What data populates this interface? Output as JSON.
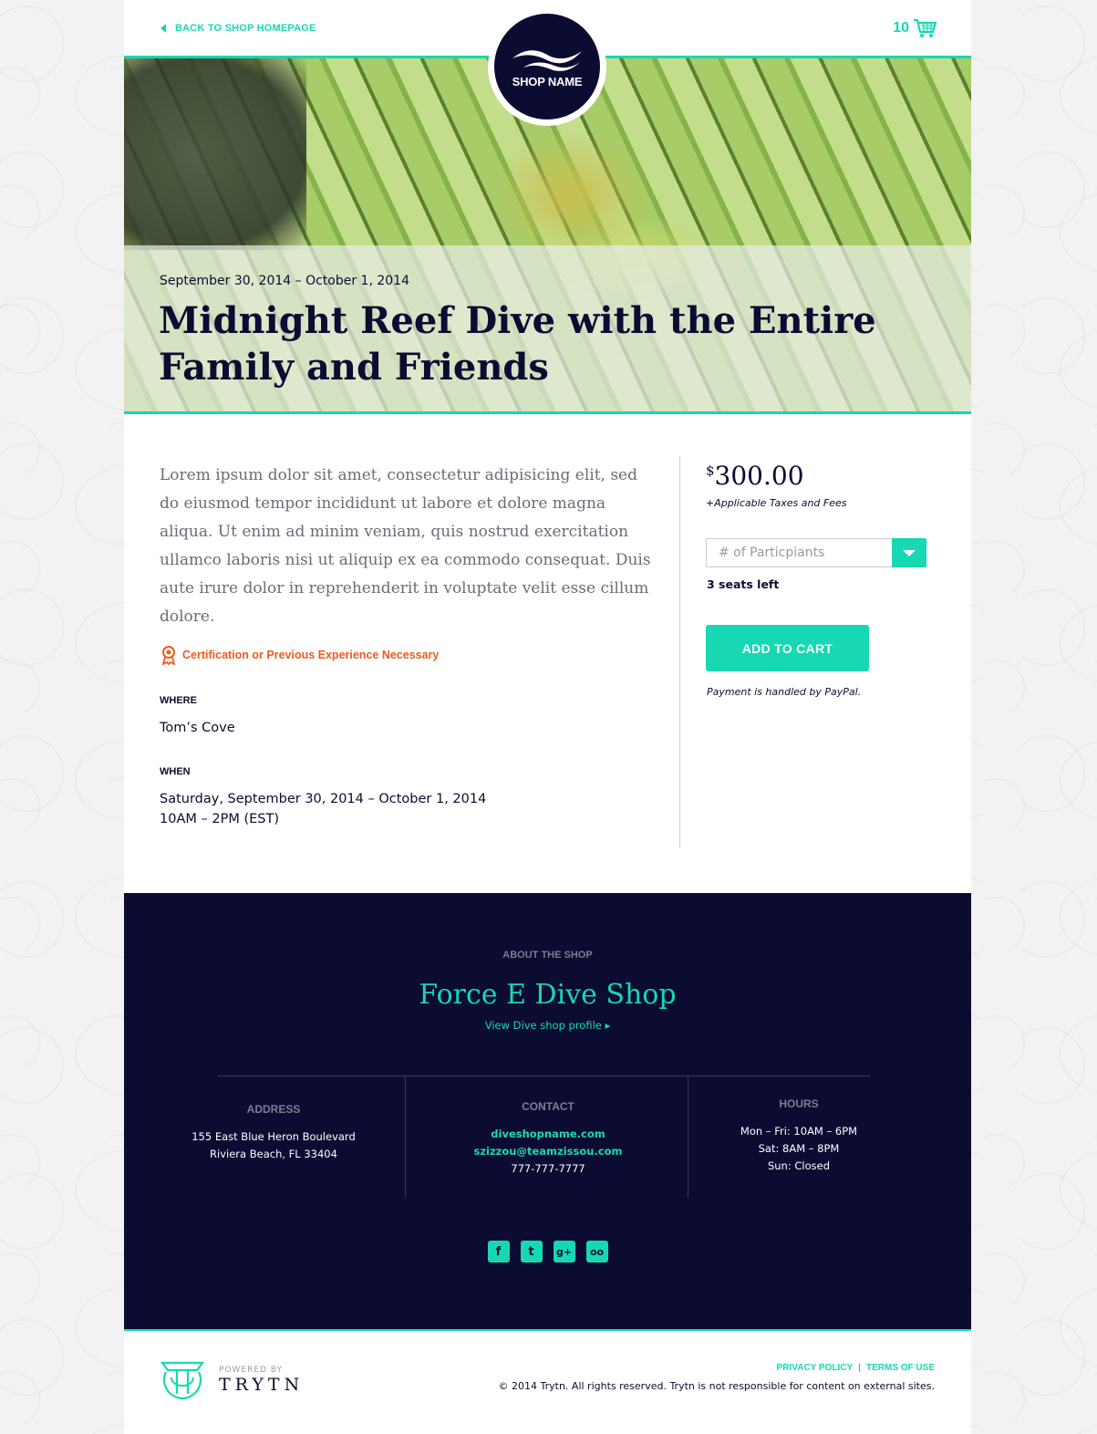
{
  "header": {
    "back_label": "BACK TO SHOP HOMEPAGE",
    "cart_count": "10",
    "logo_name": "SHOP NAME"
  },
  "event": {
    "date_range": "September 30, 2014 – October 1, 2014",
    "title": "Midnight Reef Dive with the Entire Family and Friends",
    "description": "Lorem ipsum dolor sit amet, consectetur adipisicing elit, sed do eiusmod tempor incididunt ut labore et dolore magna aliqua. Ut enim ad minim veniam, quis nostrud exercitation ullamco laboris nisi ut aliquip ex ea commodo consequat. Duis aute irure dolor in reprehenderit in voluptate velit esse cillum dolore.",
    "requirement": "Certification or Previous Experience Necessary",
    "where_label": "WHERE",
    "where_value": "Tom’s Cove",
    "when_label": "WHEN",
    "when_line1": "Saturday, September 30, 2014 – October 1, 2014",
    "when_line2": "10AM – 2PM (EST)"
  },
  "purchase": {
    "currency": "$",
    "price": "300.00",
    "taxes_note": "+Applicable Taxes and Fees",
    "participants_placeholder": "# of Particpiants",
    "seats_left": "3 seats left",
    "add_to_cart": "ADD TO CART",
    "payment_note": "Payment is handled by PayPal."
  },
  "shop": {
    "about_label": "ABOUT THE SHOP",
    "name": "Force E Dive Shop",
    "profile_link": "View Dive shop profile ▸",
    "address_title": "ADDRESS",
    "address_line1": "155 East Blue Heron Boulevard",
    "address_line2": "Riviera Beach, FL 33404",
    "contact_title": "CONTACT",
    "contact_web": "diveshopname.com",
    "contact_email": "szizzou@teamzissou.com",
    "contact_phone": "777-777-7777",
    "hours_title": "HOURS",
    "hours_line1": "Mon – Fri: 10AM – 6PM",
    "hours_line2": "Sat: 8AM – 8PM",
    "hours_line3": "Sun: Closed"
  },
  "socials": [
    {
      "name": "facebook-icon",
      "glyph": "f"
    },
    {
      "name": "twitter-icon",
      "glyph": "t"
    },
    {
      "name": "google-plus-icon",
      "glyph": "g+"
    },
    {
      "name": "tripadvisor-icon",
      "glyph": "oo"
    }
  ],
  "footer": {
    "powered_by": "POWERED BY",
    "brand": "TRYTN",
    "privacy": "PRIVACY POLICY",
    "terms": "TERMS OF USE",
    "copyright": "© 2014 Trytn. All rights reserved. Trytn is not responsible for content on external sites."
  },
  "colors": {
    "accent": "#17d8b3",
    "navy": "#0c0b32",
    "warning": "#f05a1e"
  }
}
